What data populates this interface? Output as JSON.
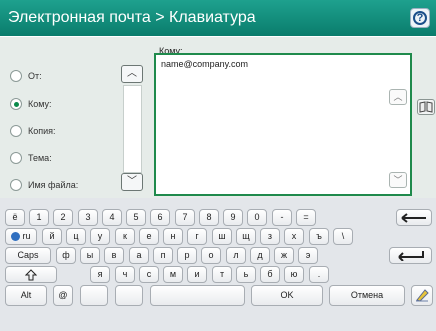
{
  "header": {
    "title": "Электронная почта > Клавиатура",
    "help_icon": "help-icon"
  },
  "form": {
    "to_label": "Кому:",
    "radios": [
      {
        "label": "От:",
        "selected": false
      },
      {
        "label": "Кому:",
        "selected": true
      },
      {
        "label": "Копия:",
        "selected": false
      },
      {
        "label": "Тема:",
        "selected": false
      },
      {
        "label": "Имя файла:",
        "selected": false
      }
    ],
    "to_value": "name@company.com"
  },
  "keyboard": {
    "row1": [
      "ё",
      "1",
      "2",
      "3",
      "4",
      "5",
      "6",
      "7",
      "8",
      "9",
      "0",
      "-",
      "="
    ],
    "lang": "ru",
    "row2": [
      "й",
      "ц",
      "у",
      "к",
      "е",
      "н",
      "г",
      "ш",
      "щ",
      "з",
      "х",
      "ъ",
      "\\"
    ],
    "caps": "Caps",
    "row3": [
      "ф",
      "ы",
      "в",
      "а",
      "п",
      "р",
      "о",
      "л",
      "д",
      "ж",
      "э"
    ],
    "row4": [
      "я",
      "ч",
      "с",
      "м",
      "и",
      "т",
      "ь",
      "б",
      "ю",
      "."
    ],
    "alt": "Alt",
    "at": "@",
    "ok": "OK",
    "cancel": "Отмена"
  },
  "colors": {
    "header": "#0a7c6c",
    "accent_green": "#1f8a4c"
  }
}
